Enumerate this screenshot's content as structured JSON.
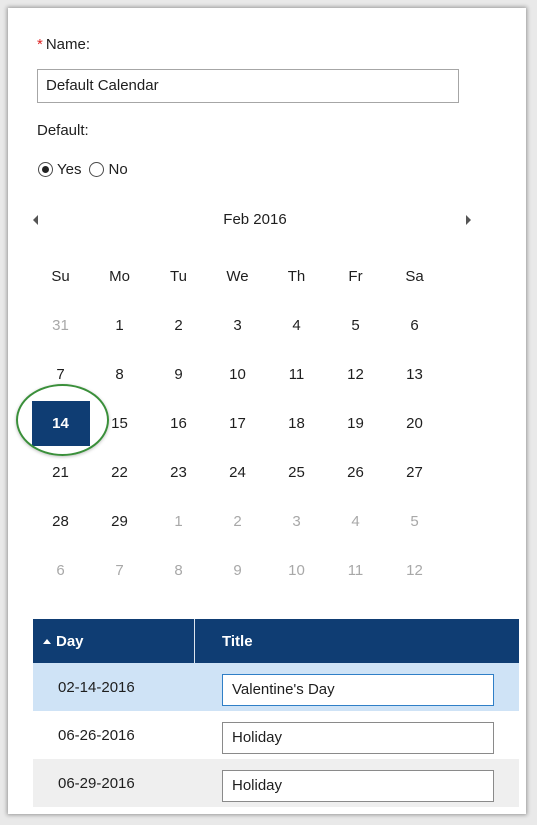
{
  "form": {
    "required_mark": "*",
    "name_label": "Name:",
    "name_value": "Default Calendar",
    "default_label": "Default:",
    "radio_yes": "Yes",
    "radio_no": "No",
    "default_selected": "Yes"
  },
  "calendar": {
    "month_title": "Feb 2016",
    "weekdays": [
      "Su",
      "Mo",
      "Tu",
      "We",
      "Th",
      "Fr",
      "Sa"
    ],
    "weeks": [
      [
        {
          "d": "31",
          "m": true
        },
        {
          "d": "1"
        },
        {
          "d": "2"
        },
        {
          "d": "3"
        },
        {
          "d": "4"
        },
        {
          "d": "5"
        },
        {
          "d": "6"
        }
      ],
      [
        {
          "d": "7"
        },
        {
          "d": "8"
        },
        {
          "d": "9"
        },
        {
          "d": "10"
        },
        {
          "d": "11"
        },
        {
          "d": "12"
        },
        {
          "d": "13"
        }
      ],
      [
        {
          "d": "14",
          "sel": true
        },
        {
          "d": "15"
        },
        {
          "d": "16"
        },
        {
          "d": "17"
        },
        {
          "d": "18"
        },
        {
          "d": "19"
        },
        {
          "d": "20"
        }
      ],
      [
        {
          "d": "21"
        },
        {
          "d": "22"
        },
        {
          "d": "23"
        },
        {
          "d": "24"
        },
        {
          "d": "25"
        },
        {
          "d": "26"
        },
        {
          "d": "27"
        }
      ],
      [
        {
          "d": "28"
        },
        {
          "d": "29"
        },
        {
          "d": "1",
          "m": true
        },
        {
          "d": "2",
          "m": true
        },
        {
          "d": "3",
          "m": true
        },
        {
          "d": "4",
          "m": true
        },
        {
          "d": "5",
          "m": true
        }
      ],
      [
        {
          "d": "6",
          "m": true
        },
        {
          "d": "7",
          "m": true
        },
        {
          "d": "8",
          "m": true
        },
        {
          "d": "9",
          "m": true
        },
        {
          "d": "10",
          "m": true
        },
        {
          "d": "11",
          "m": true
        },
        {
          "d": "12",
          "m": true
        }
      ]
    ],
    "selected_color": "#0f3d73",
    "highlight_ring_color": "#3a8f3a"
  },
  "table": {
    "col_day": "Day",
    "col_title": "Title",
    "sort_icon": "sort-ascending-icon",
    "header_color": "#0f3d73",
    "rows": [
      {
        "day": "02-14-2016",
        "title": "Valentine's Day",
        "selected": true
      },
      {
        "day": "06-26-2016",
        "title": "Holiday"
      },
      {
        "day": "06-29-2016",
        "title": "Holiday",
        "alt": true
      }
    ]
  }
}
